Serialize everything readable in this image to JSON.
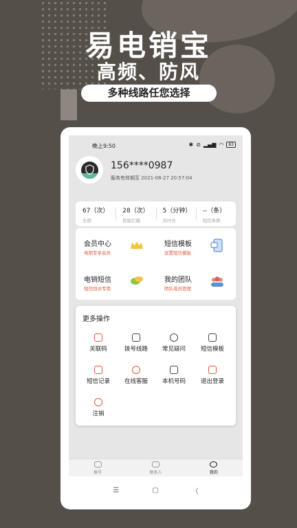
{
  "hero": {
    "title": "易电销宝",
    "subtitle": "高频、防风",
    "pill": "多种线路任您选择"
  },
  "status_bar": {
    "time": "晚上9:50",
    "battery": "83"
  },
  "profile": {
    "phone": "156****0987",
    "expiry": "服务有效期至 2021-08-27 20:57:04"
  },
  "stats": [
    {
      "value": "67（次）",
      "label": "全部"
    },
    {
      "value": "28（次）",
      "label": "智能拦截"
    },
    {
      "value": "5（分钟）",
      "label": "总时长"
    },
    {
      "value": "--（条）",
      "label": "短信条数"
    }
  ],
  "features": [
    {
      "title": "会员中心",
      "subtitle": "电销专享会员",
      "icon": "crown-icon"
    },
    {
      "title": "短信模板",
      "subtitle": "设置短信模板",
      "icon": "message-template-icon"
    },
    {
      "title": "电销短信",
      "subtitle": "短信回访专用",
      "icon": "chat-bubbles-icon"
    },
    {
      "title": "我的团队",
      "subtitle": "团队成员管理",
      "icon": "team-icon"
    }
  ],
  "more": {
    "title": "更多操作",
    "items": [
      {
        "label": "关联码",
        "icon": "link-code-icon"
      },
      {
        "label": "拨号线路",
        "icon": "layers-icon"
      },
      {
        "label": "常见疑问",
        "icon": "question-icon"
      },
      {
        "label": "短信模板",
        "icon": "grid-icon"
      },
      {
        "label": "短信记录",
        "icon": "document-icon"
      },
      {
        "label": "在线客服",
        "icon": "headset-icon"
      },
      {
        "label": "本机号码",
        "icon": "monitor-icon"
      },
      {
        "label": "退出登录",
        "icon": "logout-icon"
      },
      {
        "label": "注销",
        "icon": "cancel-icon"
      }
    ]
  },
  "tabs": [
    {
      "label": "拨号",
      "icon": "phone-icon"
    },
    {
      "label": "联系人",
      "icon": "contacts-icon"
    },
    {
      "label": "我的",
      "icon": "user-icon"
    }
  ],
  "nav": {
    "menu": "☰",
    "home": "▢",
    "back": "〈"
  },
  "colors": {
    "background": "#554f49",
    "accent": "#e05a3a"
  }
}
